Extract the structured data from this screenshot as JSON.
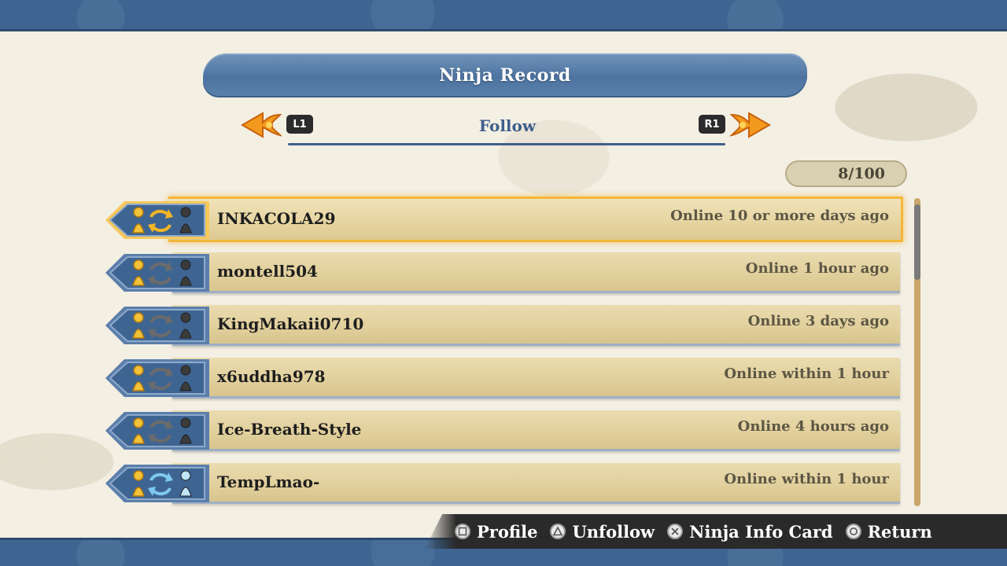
{
  "header": {
    "title": "Ninja Record",
    "tab": "Follow",
    "prev_tab_button": "L1",
    "next_tab_button": "R1"
  },
  "counter": "8/100",
  "list": {
    "items": [
      {
        "name": "INKACOLA29",
        "status": "Online 10 or more days ago",
        "selected": true,
        "icons": [
          "ninja-silhouette-gold",
          "swap-arrows-gold",
          "ninja-silhouette-dark"
        ]
      },
      {
        "name": "montell504",
        "status": "Online 1 hour ago",
        "selected": false,
        "icons": [
          "ninja-silhouette-gold",
          "swap-arrows-gray",
          "ninja-silhouette-dark"
        ]
      },
      {
        "name": "KingMakaii0710",
        "status": "Online 3 days ago",
        "selected": false,
        "icons": [
          "ninja-silhouette-gold",
          "swap-arrows-gray",
          "ninja-silhouette-dark"
        ]
      },
      {
        "name": "x6uddha978",
        "status": "Online within 1 hour",
        "selected": false,
        "icons": [
          "ninja-silhouette-gold",
          "swap-arrows-gray",
          "ninja-silhouette-dark"
        ]
      },
      {
        "name": "Ice-Breath-Style",
        "status": "Online 4 hours ago",
        "selected": false,
        "icons": [
          "ninja-silhouette-gold",
          "swap-arrows-gray",
          "ninja-silhouette-dark"
        ]
      },
      {
        "name": "TempLmao-",
        "status": "Online within 1 hour",
        "selected": false,
        "icons": [
          "ninja-silhouette-gold",
          "swap-arrows-blue",
          "ninja-silhouette-light-blue"
        ]
      }
    ]
  },
  "footer": {
    "hints": [
      {
        "glyph": "square-button-icon",
        "label": "Profile"
      },
      {
        "glyph": "triangle-button-icon",
        "label": "Unfollow"
      },
      {
        "glyph": "cross-button-icon",
        "label": "Ninja Info Card"
      },
      {
        "glyph": "circle-button-icon",
        "label": "Return"
      }
    ]
  },
  "colors": {
    "band_blue": "#3e6592",
    "accent_orange": "#f4b63c",
    "plank_tan": "#e1cf9b",
    "title_text": "#ffffff",
    "tab_text": "#3e5f8b"
  }
}
